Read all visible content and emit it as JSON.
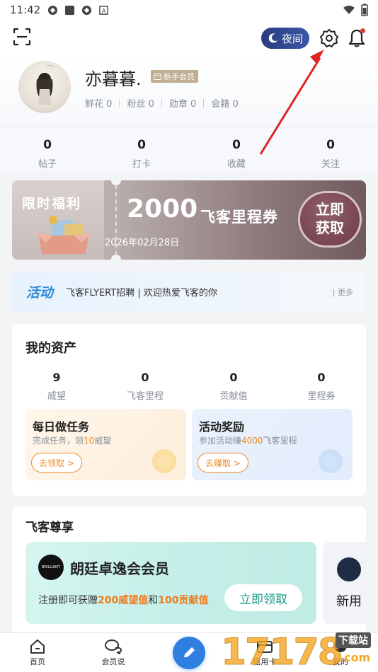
{
  "status_bar": {
    "time": "11:42"
  },
  "header": {
    "night_label": "夜间"
  },
  "profile": {
    "username": "亦暮暮.",
    "badge": "新手会员",
    "stats": [
      {
        "label": "鲜花",
        "value": "0"
      },
      {
        "label": "粉丝",
        "value": "0"
      },
      {
        "label": "勋章",
        "value": "0"
      },
      {
        "label": "会籍",
        "value": "0"
      }
    ]
  },
  "counts": [
    {
      "value": "0",
      "label": "帖子"
    },
    {
      "value": "0",
      "label": "打卡"
    },
    {
      "value": "0",
      "label": "收藏"
    },
    {
      "value": "0",
      "label": "关注"
    }
  ],
  "banner": {
    "tag": "限时福利",
    "amount": "2000",
    "unit": "飞客里程券",
    "date": "2026年02月28日",
    "button": "立即获取"
  },
  "activity": {
    "tag": "活动",
    "text": "飞客FLYERT招聘 | 欢迎热爱飞客的你",
    "more": "| 更多"
  },
  "assets": {
    "title": "我的资产",
    "items": [
      {
        "value": "9",
        "label": "威望"
      },
      {
        "value": "0",
        "label": "飞客里程"
      },
      {
        "value": "0",
        "label": "贡献值"
      },
      {
        "value": "0",
        "label": "里程券"
      }
    ],
    "tasks": [
      {
        "title": "每日做任务",
        "desc_pre": "完成任务，领",
        "desc_hl": "10",
        "desc_post": "威望",
        "button": "去领取 >"
      },
      {
        "title": "活动奖励",
        "desc_pre": "参加活动赚",
        "desc_hl": "4000",
        "desc_post": "飞客里程",
        "button": "去赚取 >"
      }
    ]
  },
  "vip": {
    "title": "飞客尊享",
    "card": {
      "name": "朗廷卓逸会会员",
      "logo_text": "BRILLIANT",
      "desc_pre": "注册即可获赠",
      "desc_hl1": "200威望值",
      "desc_mid": "和",
      "desc_hl2": "100贡献值",
      "button": "立即领取"
    },
    "card2": {
      "text": "新用"
    }
  },
  "tabbar": [
    {
      "label": "首页"
    },
    {
      "label": "会员说"
    },
    {
      "label": "信用卡"
    },
    {
      "label": "我的"
    }
  ],
  "watermark": {
    "digits": "17178",
    "tag": "下载站",
    "domain": ".com"
  },
  "colors": {
    "accent": "#2f7fe0",
    "orange": "#f08a24",
    "annotation_arrow": "#e02424"
  }
}
